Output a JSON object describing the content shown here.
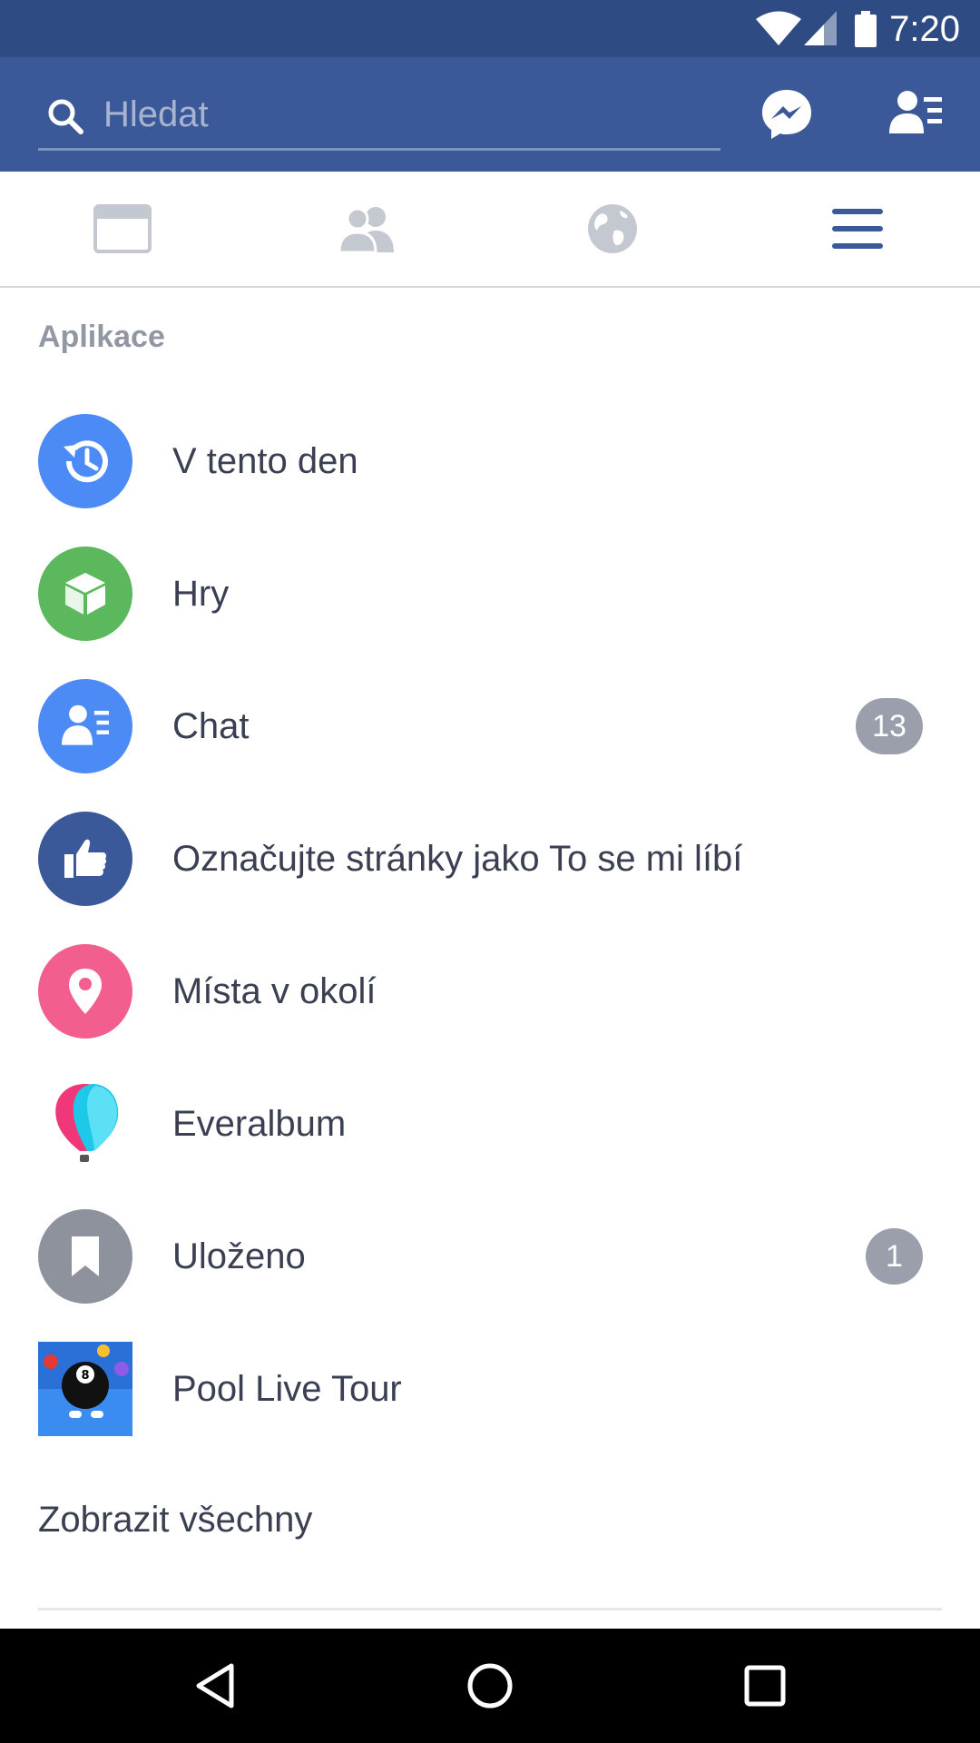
{
  "status_bar": {
    "time": "7:20"
  },
  "search": {
    "placeholder": "Hledat"
  },
  "header": {
    "messenger_icon": "messenger-icon",
    "contacts_icon": "contacts-list-icon"
  },
  "tabs": [
    {
      "icon": "news-feed-icon",
      "active": false
    },
    {
      "icon": "friends-icon",
      "active": false
    },
    {
      "icon": "globe-icon",
      "active": false
    },
    {
      "icon": "menu-icon",
      "active": true
    }
  ],
  "apps": {
    "section_title": "Aplikace",
    "items": [
      {
        "label": "V tento den",
        "icon": "history-clock-icon",
        "color": "#4c8bf5"
      },
      {
        "label": "Hry",
        "icon": "cube-icon",
        "color": "#5bb85d"
      },
      {
        "label": "Chat",
        "icon": "contacts-list-icon",
        "color": "#4c8bf5",
        "badge": "13"
      },
      {
        "label": "Označujte stránky jako To se mi líbí",
        "icon": "thumbs-up-icon",
        "color": "#3b5998"
      },
      {
        "label": "Místa v okolí",
        "icon": "location-pin-icon",
        "color": "#f25f8f"
      },
      {
        "label": "Everalbum",
        "icon": "balloon-icon",
        "color": "#1ec8e8"
      },
      {
        "label": "Uloženo",
        "icon": "bookmark-icon",
        "color": "#8d929c",
        "badge": "1"
      },
      {
        "label": "Pool Live Tour",
        "icon": "eight-ball-icon",
        "color": "#2a70d6"
      }
    ],
    "see_all": "Zobrazit všechny"
  },
  "nav": {
    "back_icon": "back-triangle-icon",
    "home_icon": "home-circle-icon",
    "recents_icon": "recents-square-icon"
  },
  "colors": {
    "brand": "#3b5998",
    "status_bar": "#2f4b84",
    "badge": "#9a9fab",
    "text": "#3a4052",
    "muted": "#9197a3"
  }
}
